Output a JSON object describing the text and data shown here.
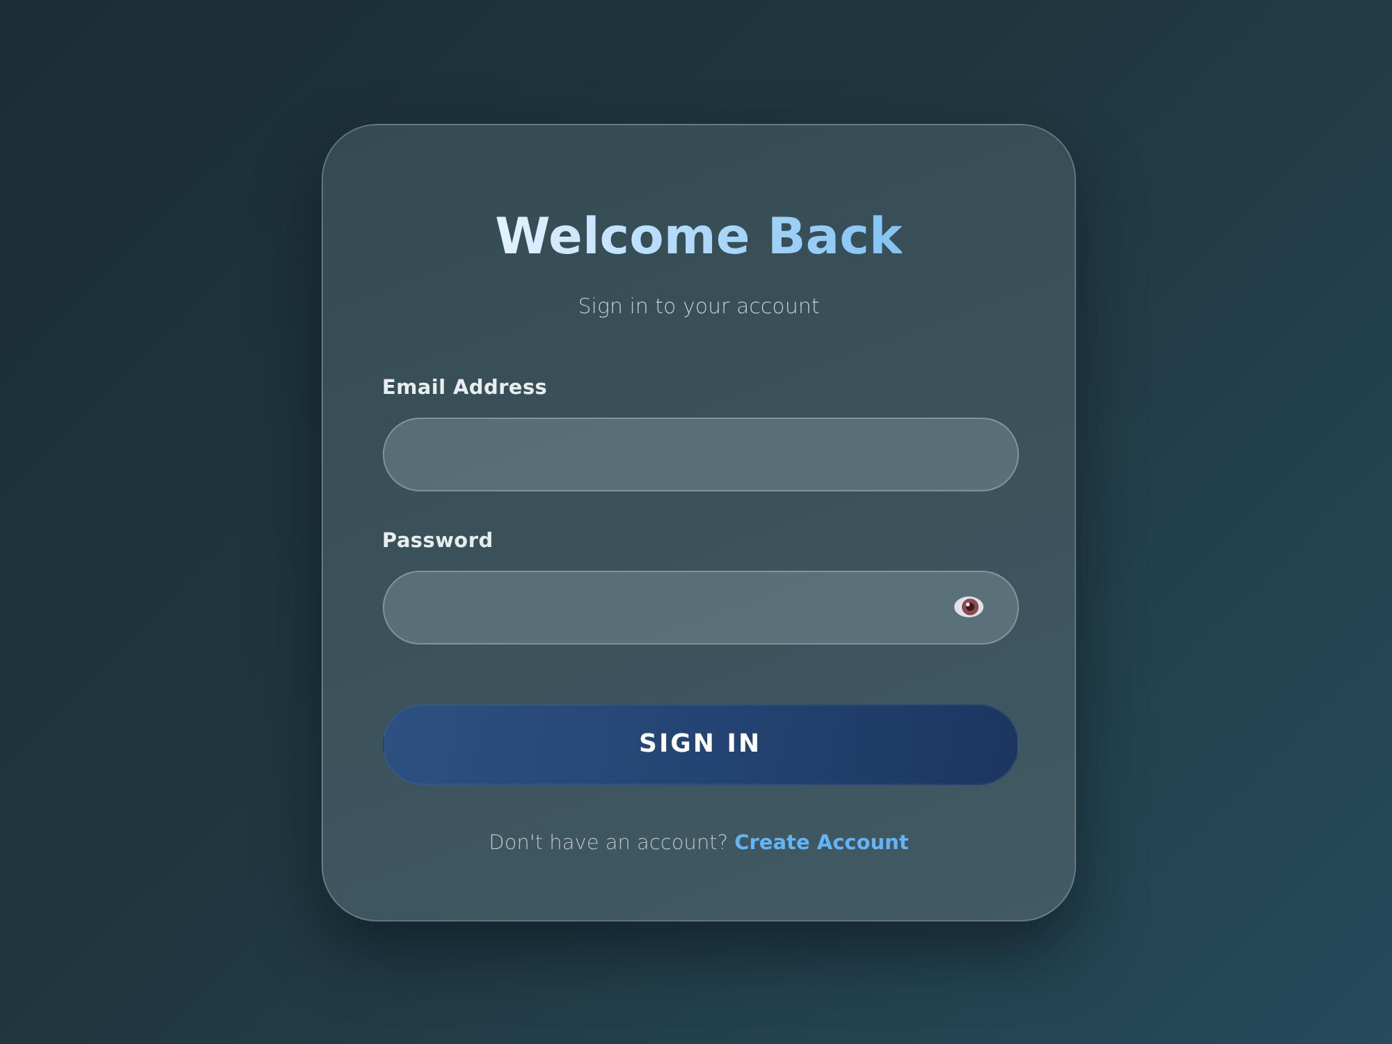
{
  "title": "Welcome Back",
  "subtitle": "Sign in to your account",
  "fields": [
    {
      "label": "Email Address",
      "kind": "email"
    },
    {
      "label": "Password",
      "kind": "password"
    }
  ],
  "submit": {
    "label": "SIGN IN"
  },
  "footer": {
    "text": "Don't have an account?",
    "link": "Create Account"
  }
}
